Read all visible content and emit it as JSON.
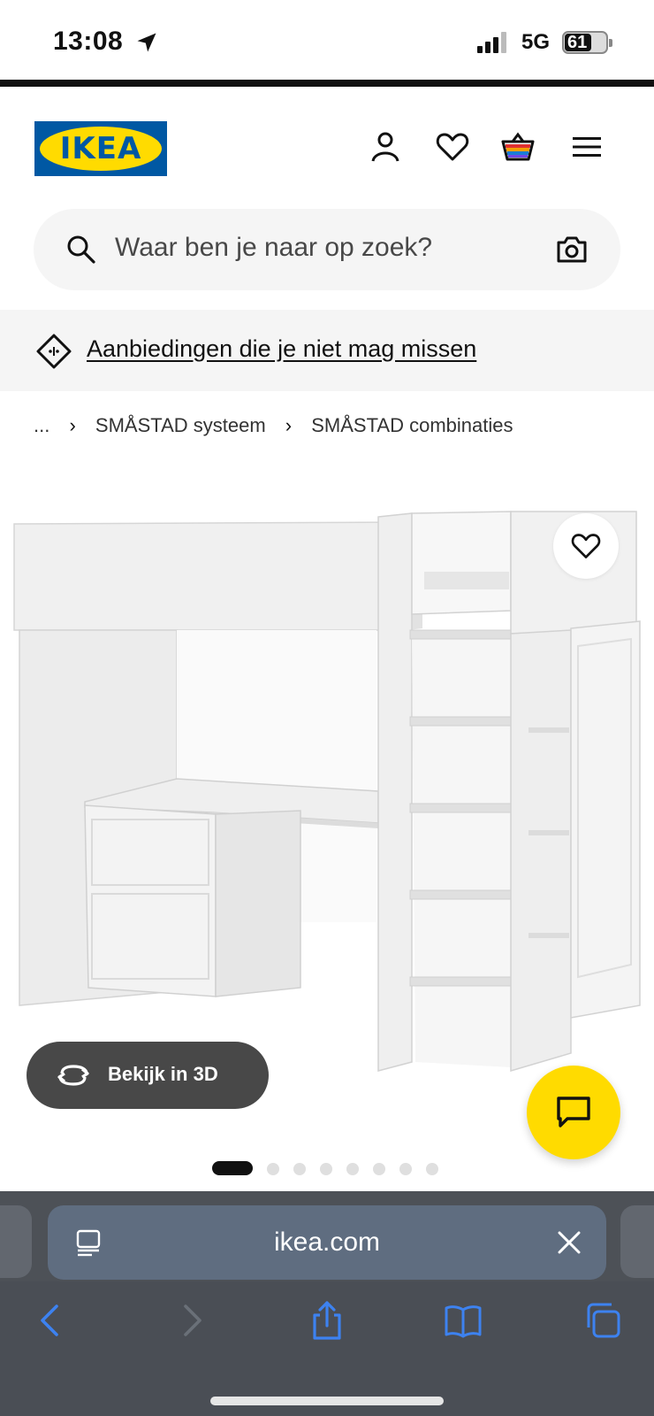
{
  "status_bar": {
    "time": "13:08",
    "network": "5G",
    "battery": "61"
  },
  "header": {
    "logo_text": "IKEA",
    "icons": [
      "user-icon",
      "heart-icon",
      "basket-icon",
      "menu-icon"
    ]
  },
  "search": {
    "placeholder": "Waar ben je naar op zoek?"
  },
  "promo": {
    "label": "Aanbiedingen die je niet mag missen"
  },
  "breadcrumb": {
    "ellipsis": "...",
    "items": [
      "SMÅSTAD systeem",
      "SMÅSTAD combinaties"
    ]
  },
  "product": {
    "view3d_label": "Bekijk in 3D",
    "carousel": {
      "total": 8,
      "active_index": 0
    }
  },
  "browser": {
    "url": "ikea.com"
  },
  "colors": {
    "ikea_blue": "#0058a3",
    "ikea_yellow": "#ffdb00",
    "safari_bg": "#4a4e55",
    "safari_url_bg": "#5f6d80",
    "safari_icon": "#3d82f0"
  }
}
